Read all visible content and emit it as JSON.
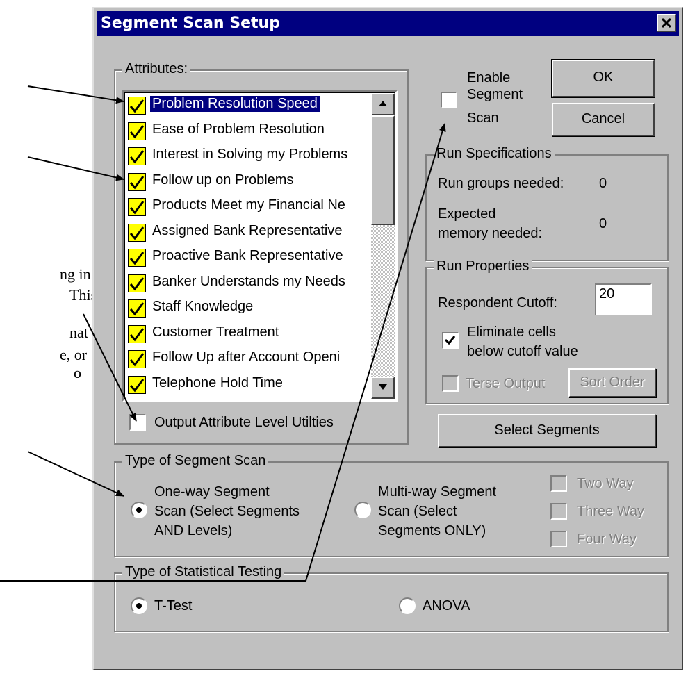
{
  "annotation_fragments": [
    "ng in",
    "This",
    "nat",
    "e, or",
    "o"
  ],
  "dialog": {
    "title": "Segment Scan Setup",
    "close_glyph": "✕"
  },
  "attributes": {
    "legend": "Attributes:",
    "items": [
      {
        "label": "Problem Resolution Speed",
        "checked": true,
        "selected": true
      },
      {
        "label": "Ease of Problem Resolution",
        "checked": true
      },
      {
        "label": "Interest in Solving my Problems",
        "checked": true
      },
      {
        "label": "Follow up on Problems",
        "checked": true
      },
      {
        "label": "Products Meet my Financial Ne",
        "checked": true
      },
      {
        "label": "Assigned Bank Representative",
        "checked": true
      },
      {
        "label": "Proactive Bank Representative",
        "checked": true
      },
      {
        "label": "Banker Understands my Needs",
        "checked": true
      },
      {
        "label": "Staff Knowledge",
        "checked": true
      },
      {
        "label": "Customer Treatment",
        "checked": true
      },
      {
        "label": "Follow Up after Account Openi",
        "checked": true
      },
      {
        "label": "Telephone Hold Time",
        "checked": true
      }
    ],
    "output_utilities_label": "Output Attribute Level Utilties",
    "check_color": "#ffff00"
  },
  "enable_scan": {
    "label_line1": "Enable",
    "label_line2": "Segment",
    "label_line3": "Scan"
  },
  "buttons": {
    "ok": "OK",
    "cancel": "Cancel",
    "select_segments": "Select Segments",
    "sort_order": "Sort Order"
  },
  "run_specs": {
    "legend": "Run Specifications",
    "groups_label": "Run groups needed:",
    "groups_value": "0",
    "memory_label_line1": "Expected",
    "memory_label_line2": "memory needed:",
    "memory_value": "0"
  },
  "run_props": {
    "legend": "Run Properties",
    "cutoff_label": "Respondent Cutoff:",
    "cutoff_value": "20",
    "eliminate_line1": "Eliminate cells",
    "eliminate_line2": "below cutoff value",
    "terse_label": "Terse Output"
  },
  "scan_type": {
    "legend": "Type of Segment Scan",
    "oneway_line1": "One-way Segment",
    "oneway_line2": "Scan (Select Segments",
    "oneway_line3": "AND Levels)",
    "multiway_line1": "Multi-way Segment",
    "multiway_line2": "Scan (Select",
    "multiway_line3": "Segments ONLY)",
    "two_way": "Two Way",
    "three_way": "Three Way",
    "four_way": "Four Way"
  },
  "stat_test": {
    "legend": "Type of Statistical Testing",
    "ttest": "T-Test",
    "anova": "ANOVA"
  }
}
